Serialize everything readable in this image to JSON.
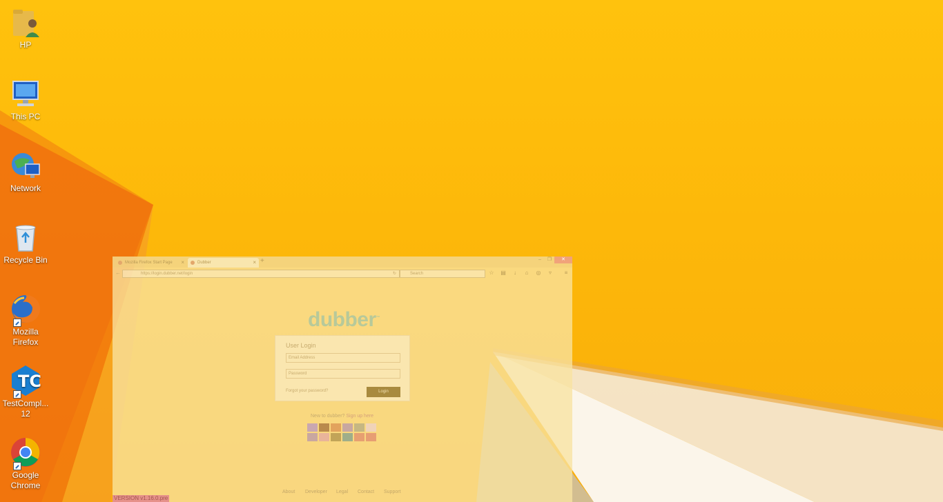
{
  "desktop_icons": [
    {
      "label": "HP",
      "icon": "user-folder-icon"
    },
    {
      "label": "This PC",
      "icon": "computer-icon"
    },
    {
      "label": "Network",
      "icon": "network-icon"
    },
    {
      "label": "Recycle Bin",
      "icon": "recycle-bin-icon"
    },
    {
      "label": "Mozilla Firefox",
      "icon": "firefox-icon",
      "shortcut": true
    },
    {
      "label": "TestCompl... 12",
      "icon": "testcomplete-icon",
      "shortcut": true
    },
    {
      "label": "Google Chrome",
      "icon": "chrome-icon",
      "shortcut": true
    }
  ],
  "browser": {
    "tabs": [
      {
        "title": "Mozilla Firefox Start Page"
      },
      {
        "title": "Dubber"
      }
    ],
    "url": "https://login.dubber.net/login",
    "search_placeholder": "Search",
    "page": {
      "logo": "dubber",
      "login_title": "User Login",
      "email_placeholder": "Email Address",
      "password_placeholder": "Password",
      "forgot_link": "Forgot your password?",
      "login_button": "Login",
      "new_prompt": "New to dubber?",
      "signup_link": "Sign up here",
      "footer_links": [
        "About",
        "Developer",
        "Legal",
        "Contact",
        "Support"
      ],
      "version": "VERSION v1.16.0.pre"
    },
    "flags": [
      {
        "name": "uk-flag",
        "color": "#c9a7b0"
      },
      {
        "name": "germany-flag",
        "color": "#b98a4c"
      },
      {
        "name": "spain-flag",
        "color": "#e2a35d"
      },
      {
        "name": "france-flag",
        "color": "#c8a8a0"
      },
      {
        "name": "italy-flag",
        "color": "#c6b782"
      },
      {
        "name": "japan-flag",
        "color": "#f0d3b8"
      },
      {
        "name": "netherlands-flag",
        "color": "#c9a7a0"
      },
      {
        "name": "poland-flag",
        "color": "#e9b49a"
      },
      {
        "name": "portugal-flag",
        "color": "#c2a458"
      },
      {
        "name": "sweden-flag",
        "color": "#9fae8a"
      },
      {
        "name": "china-flag",
        "color": "#e7a071"
      },
      {
        "name": "taiwan-flag",
        "color": "#e79e73"
      }
    ]
  }
}
